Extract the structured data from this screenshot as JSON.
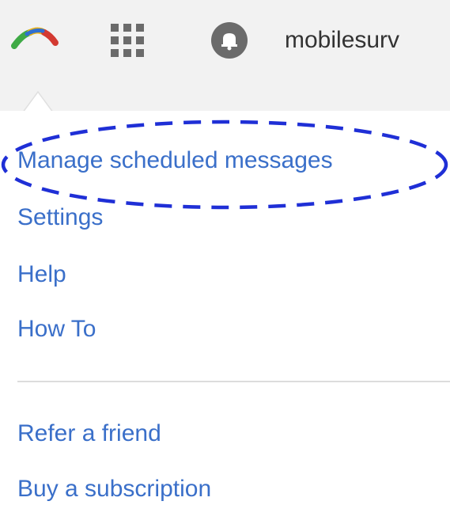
{
  "topbar": {
    "logo_icon": "rainbow-arc-logo",
    "apps_icon": "grid-apps-icon",
    "notifications_icon": "bell-icon",
    "account_name": "mobilesurv"
  },
  "menu": {
    "items": [
      {
        "label": "Manage scheduled messages",
        "highlighted": true
      },
      {
        "label": "Settings"
      },
      {
        "label": "Help"
      },
      {
        "label": "How To"
      }
    ],
    "secondary_items": [
      {
        "label": "Refer a friend"
      },
      {
        "label": "Buy a subscription"
      }
    ]
  },
  "colors": {
    "link": "#3a6fc9",
    "highlight_annotation": "#1f2fd6",
    "topbar_background": "#f2f2f2"
  }
}
